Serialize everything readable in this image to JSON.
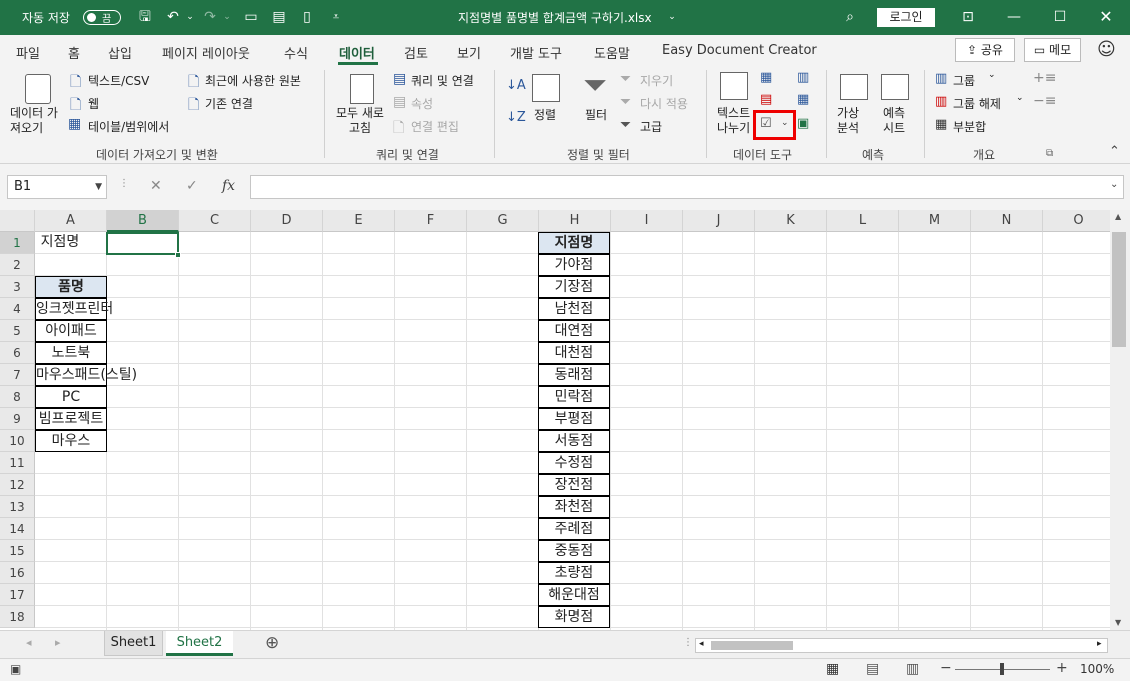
{
  "titlebar": {
    "autosave_label": "자동 저장",
    "autosave_state": "끔",
    "filename": "지점명별 품명별 합계금액 구하기.xlsx",
    "login": "로그인"
  },
  "tabs": [
    "파일",
    "홈",
    "삽입",
    "페이지 레이아웃",
    "수식",
    "데이터",
    "검토",
    "보기",
    "개발 도구",
    "도움말",
    "Easy Document Creator"
  ],
  "share_label": "공유",
  "memo_label": "메모",
  "ribbon": {
    "get_data": {
      "button": "데이터 가\n져오기",
      "text_csv": "텍스트/CSV",
      "web": "웹",
      "table_range": "테이블/범위에서",
      "recent_sources": "최근에 사용한 원본",
      "existing_conn": "기존 연결",
      "group_label": "데이터 가져오기 및 변환"
    },
    "queries": {
      "refresh_all": "모두 새로\n고침",
      "queries_conn": "쿼리 및 연결",
      "properties": "속성",
      "edit_links": "연결 편집",
      "group_label": "쿼리 및 연결"
    },
    "sort_filter": {
      "sort": "정렬",
      "filter": "필터",
      "clear": "지우기",
      "reapply": "다시 적용",
      "advanced": "고급",
      "group_label": "정렬 및 필터"
    },
    "data_tools": {
      "text_to_columns": "텍스트\n나누기",
      "group_label": "데이터 도구"
    },
    "forecast": {
      "what_if": "가상\n분석",
      "forecast_sheet": "예측\n시트",
      "group_label": "예측"
    },
    "outline": {
      "group": "그룹",
      "ungroup": "그룹 해제",
      "subtotal": "부분합",
      "group_label": "개요"
    }
  },
  "formula_bar": {
    "name_box": "B1",
    "formula": "",
    "fx": "fx"
  },
  "columns": [
    "A",
    "B",
    "C",
    "D",
    "E",
    "F",
    "G",
    "H",
    "I",
    "J",
    "K",
    "L",
    "M",
    "N",
    "O"
  ],
  "rows": [
    "1",
    "2",
    "3",
    "4",
    "5",
    "6",
    "7",
    "8",
    "9",
    "10",
    "11",
    "12",
    "13",
    "14",
    "15",
    "16",
    "17",
    "18"
  ],
  "cells": {
    "a1": "지점명",
    "a3": "품명",
    "products": [
      "잉크젯프린터",
      "아이패드",
      "노트북",
      "마우스패드(스틸)",
      "PC",
      "빔프로젝트",
      "마우스"
    ],
    "h1": "지점명",
    "branches": [
      "가야점",
      "기장점",
      "남천점",
      "대연점",
      "대천점",
      "동래점",
      "민락점",
      "부평점",
      "서동점",
      "수정점",
      "장전점",
      "좌천점",
      "주례점",
      "중동점",
      "초량점",
      "해운대점",
      "화명점"
    ]
  },
  "sheets": [
    "Sheet1",
    "Sheet2"
  ],
  "active_sheet": "Sheet2",
  "status": {
    "zoom": "100%"
  },
  "colors": {
    "accent": "#217346",
    "highlight": "#e00000"
  }
}
